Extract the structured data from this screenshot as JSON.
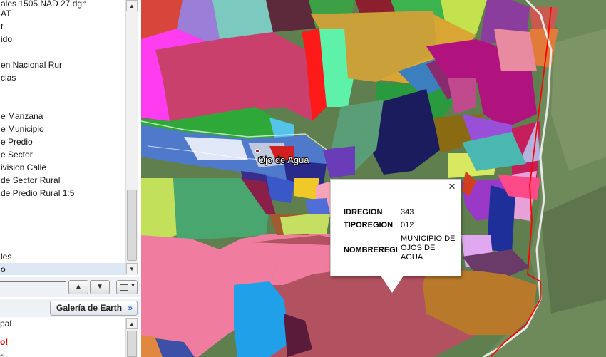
{
  "left_panel": {
    "layers": [
      "ales 1505 NAD 27.dgn",
      "AT",
      "t",
      "ido",
      "",
      "en Nacional Rur",
      "cias",
      "",
      "",
      "e Manzana",
      "e Municipio",
      "e Predio",
      "e Sector",
      "ivision Calle",
      "de Sector Rural",
      "de Predio Rural 1:5",
      "",
      "",
      "",
      "",
      "les",
      "o"
    ],
    "places": [
      "pal",
      "o!",
      "ri... ... ... ... ..."
    ]
  },
  "gallery_button_label": "Galería de Earth",
  "map": {
    "place_label": "Ojo de Agua"
  },
  "info_balloon": {
    "attributes": [
      {
        "key": "IDREGION",
        "value": "343"
      },
      {
        "key": "TIPOREGION",
        "value": "012"
      },
      {
        "key": "NOMBREREGI",
        "value": "MUNICIPIO DE OJOS DE AGUA"
      }
    ],
    "close_glyph": "×"
  },
  "colors": {
    "boundary_line": "#ff0000",
    "selected_row": "#dde8f4",
    "panel_border": "#9aa4b1",
    "gallery_chevron": "#3b74c4"
  }
}
